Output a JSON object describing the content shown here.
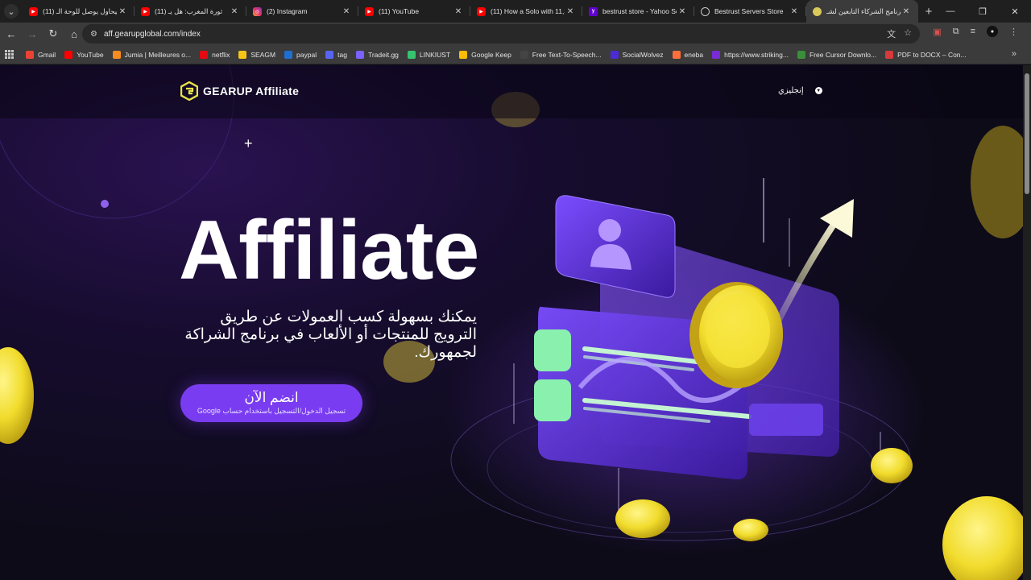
{
  "browser": {
    "tabs": [
      {
        "title": "(11) بيحاول يوصل للوحة الـ",
        "favicon": "youtube-icon"
      },
      {
        "title": "(11) ثورة المغرب: هل يـ",
        "favicon": "youtube-icon"
      },
      {
        "title": "(2) Instagram",
        "favicon": "instagram-icon"
      },
      {
        "title": "(11) YouTube",
        "favicon": "youtube-icon"
      },
      {
        "title": "(11) How a Solo with 11,3",
        "favicon": "youtube-icon"
      },
      {
        "title": "bestrust store - Yahoo Se",
        "favicon": "yahoo-icon"
      },
      {
        "title": "Bestrust Servers Store",
        "favicon": "globe-icon"
      },
      {
        "title": "برنامج الشركاء التابعين لشـ",
        "favicon": "gearup-icon",
        "active": true
      }
    ],
    "url": "aff.gearupglobal.com/index",
    "bookmarks": [
      {
        "label": "Gmail",
        "color": "#ea4335"
      },
      {
        "label": "YouTube",
        "color": "#ff0000"
      },
      {
        "label": "Jumia | Meilleures o...",
        "color": "#f68b1e"
      },
      {
        "label": "netflix",
        "color": "#e50914"
      },
      {
        "label": "SEAGM",
        "color": "#f5c518"
      },
      {
        "label": "paypal",
        "color": "#1f6fd1"
      },
      {
        "label": "tag",
        "color": "#5865f2"
      },
      {
        "label": "Tradeit.gg",
        "color": "#7b61ff"
      },
      {
        "label": "LINKIUST",
        "color": "#36c26e"
      },
      {
        "label": "Google Keep",
        "color": "#fbbc04"
      },
      {
        "label": "Free Text-To-Speech...",
        "color": "#444444"
      },
      {
        "label": "SocialWolvez",
        "color": "#4b2bd6"
      },
      {
        "label": "eneba",
        "color": "#ff6f3c"
      },
      {
        "label": "https://www.striking...",
        "color": "#7a2bd6"
      },
      {
        "label": "Free Cursor Downlo...",
        "color": "#3a8f3a"
      },
      {
        "label": "PDF to DOCX – Con...",
        "color": "#d63a3a"
      }
    ]
  },
  "site": {
    "logo_text": "GEARUP Affiliate",
    "language_label": "إنجليزي",
    "hero_title": "Affiliate",
    "hero_description": "يمكنك بسهولة كسب العمولات عن طريق الترويج للمنتجات أو الألعاب في برنامج الشراكة لجمهورك.",
    "cta_main": "انضم الآن",
    "cta_sub": "تسجيل الدخول/التسجيل باستخدام حساب Google"
  },
  "colors": {
    "accent": "#7a3cf0",
    "logo_yellow": "#e8e34a",
    "coin_yellow": "#f3e24a",
    "green": "#7ee6a0"
  }
}
